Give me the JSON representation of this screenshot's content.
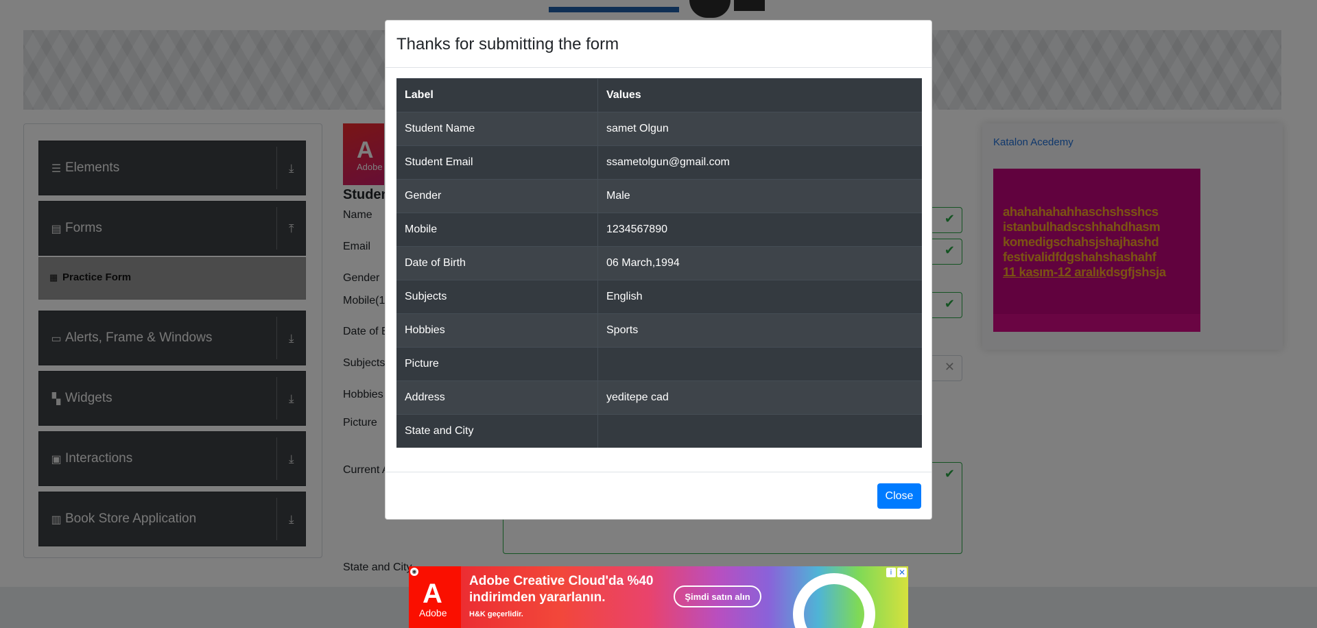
{
  "sidebar": {
    "groups": [
      {
        "label": "Elements",
        "icon": "hamburger-icon"
      },
      {
        "label": "Forms",
        "icon": "document-icon"
      },
      {
        "label": "Alerts, Frame & Windows",
        "icon": "window-icon"
      },
      {
        "label": "Widgets",
        "icon": "grid-icon"
      },
      {
        "label": "Interactions",
        "icon": "cursor-box-icon"
      },
      {
        "label": "Book Store Application",
        "icon": "books-icon"
      }
    ],
    "active_item": "Practice Form"
  },
  "form": {
    "title": "Studen",
    "labels": [
      "Name",
      "Email",
      "Gender",
      "Mobile(1",
      "Date of B",
      "Subjects",
      "Hobbies",
      "Picture",
      "Current A",
      "State and City"
    ]
  },
  "ad_thumb": {
    "brand": "Adobe"
  },
  "right_ad": {
    "link_text": "Katalon Acedemy",
    "poster_lines": [
      "ahahahahahhaschshsshcs",
      "istanbulhadscshhahdhasm",
      "komedigschahsjshajhashd",
      "festivalidfdgshahshashahf"
    ],
    "poster_underlined": "11 kasım-12 aralık",
    "poster_tail": "dsgfjshsja"
  },
  "modal": {
    "title": "Thanks for submitting the form",
    "headers": [
      "Label",
      "Values"
    ],
    "rows": [
      [
        "Student Name",
        "samet Olgun"
      ],
      [
        "Student Email",
        "ssametolgun@gmail.com"
      ],
      [
        "Gender",
        "Male"
      ],
      [
        "Mobile",
        "1234567890"
      ],
      [
        "Date of Birth",
        "06 March,1994"
      ],
      [
        "Subjects",
        "English"
      ],
      [
        "Hobbies",
        "Sports"
      ],
      [
        "Picture",
        ""
      ],
      [
        "Address",
        "yeditepe cad"
      ],
      [
        "State and City",
        ""
      ]
    ],
    "close_label": "Close"
  },
  "bottom_ad": {
    "brand": "Adobe",
    "headline": "Adobe Creative Cloud'da %40 indirimden yararlanın.",
    "note": "H&K geçerlidir.",
    "cta": "Şimdi satın alın"
  },
  "colors": {
    "primary": "#007bff",
    "sidebar": "#3d4144",
    "valid": "#28a745",
    "table": "#343a40"
  }
}
